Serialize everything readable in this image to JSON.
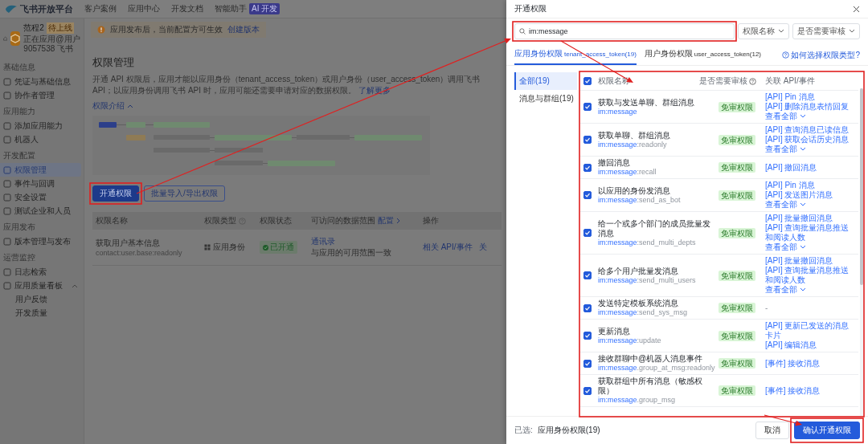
{
  "top_nav": {
    "logo": "飞书开放平台",
    "links": [
      {
        "label": "客户案例"
      },
      {
        "label": "应用中心"
      },
      {
        "label": "开发文档"
      },
      {
        "label": "智能助手",
        "badge": "AI 开发"
      }
    ]
  },
  "app_header": {
    "name": "范程2",
    "tag": "待上线",
    "subtitle": "正在应用@用户9057538 飞书",
    "notice": "应用发布后，当前配置方可生效",
    "notice_link": "创建版本"
  },
  "sidebar": {
    "groups": [
      {
        "title": "基础信息",
        "items": [
          {
            "label": "凭证与基础信息",
            "selected": false
          },
          {
            "label": "协作者管理",
            "selected": false
          }
        ]
      },
      {
        "title": "应用能力",
        "items": [
          {
            "label": "添加应用能力",
            "selected": false
          },
          {
            "label": "机器人",
            "selected": false
          }
        ]
      },
      {
        "title": "开发配置",
        "items": [
          {
            "label": "权限管理",
            "selected": true
          },
          {
            "label": "事件与回调",
            "selected": false
          },
          {
            "label": "安全设置",
            "selected": false
          },
          {
            "label": "测试企业和人员",
            "selected": false
          }
        ]
      },
      {
        "title": "应用发布",
        "items": [
          {
            "label": "版本管理与发布",
            "selected": false
          }
        ]
      },
      {
        "title": "运营监控",
        "items": [
          {
            "label": "日志检索",
            "selected": false
          },
          {
            "label": "应用质量看板",
            "selected": false,
            "expanded": true,
            "children": [
              {
                "label": "用户反馈",
                "selected": false
              },
              {
                "label": "开发质量",
                "selected": false
              }
            ]
          }
        ]
      }
    ]
  },
  "main": {
    "title": "权限管理",
    "description": "开通 API 权限后，应用才能以应用身份（tenant_access_token）或用户身份（user_access_token）调用飞书 API；以应用身份调用飞书 API 时，应用可能还需要申请对应的数据权限。",
    "learn_more": "了解更多",
    "intro_toggle": {
      "label": "权限介绍",
      "expanded": true
    },
    "buttons": [
      {
        "label": "开通权限",
        "kind": "primary"
      },
      {
        "label": "批量导入/导出权限",
        "kind": "secondary"
      }
    ],
    "table": {
      "columns": [
        {
          "label": "权限名称"
        },
        {
          "label": "权限类型",
          "help": true
        },
        {
          "label": "权限状态"
        },
        {
          "label": "可访问的数据范围",
          "action": "配置"
        },
        {
          "label": "操作"
        }
      ],
      "rows": [
        {
          "name": "获取用户基本信息",
          "scope": "contact:user.base:readonly",
          "type": "应用身份",
          "status": "已开通",
          "data_scope": "通讯录",
          "data_scope_note": "与应用的可用范围一致",
          "actions": [
            "相关 API/事件",
            "关"
          ]
        }
      ]
    }
  },
  "drawer": {
    "title": "开通权限",
    "search": {
      "value": "im:message"
    },
    "filters": [
      {
        "label": "权限名称"
      },
      {
        "label": "是否需要审核"
      }
    ],
    "tabs": [
      {
        "label": "应用身份权限",
        "token": "tenant_access_token(19)",
        "selected": true
      },
      {
        "label": "用户身份权限",
        "token": "user_access_token(12)",
        "selected": false
      }
    ],
    "help_link": "如何选择权限类型?",
    "categories": [
      {
        "label": "全部(19)",
        "selected": true
      },
      {
        "label": "消息与群组(19)",
        "selected": false
      }
    ],
    "table": {
      "all_checked": true,
      "columns": [
        {
          "label": "权限名称"
        },
        {
          "label": "是否需要审核",
          "help": true
        },
        {
          "label": "关联 API/事件"
        }
      ],
      "rows": [
        {
          "name": "获取与发送单聊、群组消息",
          "scope": "im:message",
          "checked": true,
          "badge": "免审权限",
          "links": [
            "[API] Pin 消息",
            "[API] 删除消息表情回复"
          ],
          "more": "查看全部"
        },
        {
          "name": "获取单聊、群组消息",
          "scope": "im:message",
          "scope_suffix": ":readonly",
          "checked": true,
          "badge": "免审权限",
          "links": [
            "[API] 查询消息已读信息",
            "[API] 获取会话历史消息"
          ],
          "more": "查看全部"
        },
        {
          "name": "撤回消息",
          "scope": "im:message",
          "scope_suffix": ":recall",
          "checked": true,
          "badge": "免审权限",
          "links": [
            "[API] 撤回消息"
          ]
        },
        {
          "name": "以应用的身份发消息",
          "scope": "im:message",
          "scope_suffix": ":send_as_bot",
          "checked": true,
          "badge": "免审权限",
          "links": [
            "[API] Pin 消息",
            "[API] 发送图片消息"
          ],
          "more": "查看全部"
        },
        {
          "name": "给一个或多个部门的成员批量发消息",
          "scope": "im:message",
          "scope_suffix": ":send_multi_depts",
          "checked": true,
          "badge": "免审权限",
          "links": [
            "[API] 批量撤回消息",
            "[API] 查询批量消息推送和阅读人数"
          ],
          "more": "查看全部"
        },
        {
          "name": "给多个用户批量发消息",
          "scope": "im:message",
          "scope_suffix": ":send_multi_users",
          "checked": true,
          "badge": "免审权限",
          "links": [
            "[API] 批量撤回消息",
            "[API] 查询批量消息推送和阅读人数"
          ],
          "more": "查看全部"
        },
        {
          "name": "发送特定模板系统消息",
          "scope": "im:message",
          "scope_suffix": ":send_sys_msg",
          "checked": true,
          "badge": "免审权限",
          "empty_mark": "-"
        },
        {
          "name": "更新消息",
          "scope": "im:message",
          "scope_suffix": ":update",
          "checked": true,
          "badge": "免审权限",
          "links": [
            "[API] 更新已发送的消息卡片",
            "[API] 编辑消息"
          ]
        },
        {
          "name": "接收群聊中@机器人消息事件",
          "scope": "im:message",
          "scope_suffix": ".group_at_msg:readonly",
          "checked": true,
          "badge": "免审权限",
          "links": [
            "[事件] 接收消息"
          ]
        },
        {
          "name": "获取群组中所有消息（敏感权限）",
          "scope": "im:message",
          "scope_suffix": ".group_msg",
          "checked": true,
          "badge": "免审权限",
          "links": [
            "[事件] 接收消息"
          ]
        }
      ]
    },
    "footer": {
      "selected_label": "已选:",
      "selected_value": "应用身份权限(19)",
      "buttons": [
        {
          "label": "取消",
          "kind": "secondary"
        },
        {
          "label": "确认开通权限",
          "kind": "primary"
        }
      ]
    }
  }
}
